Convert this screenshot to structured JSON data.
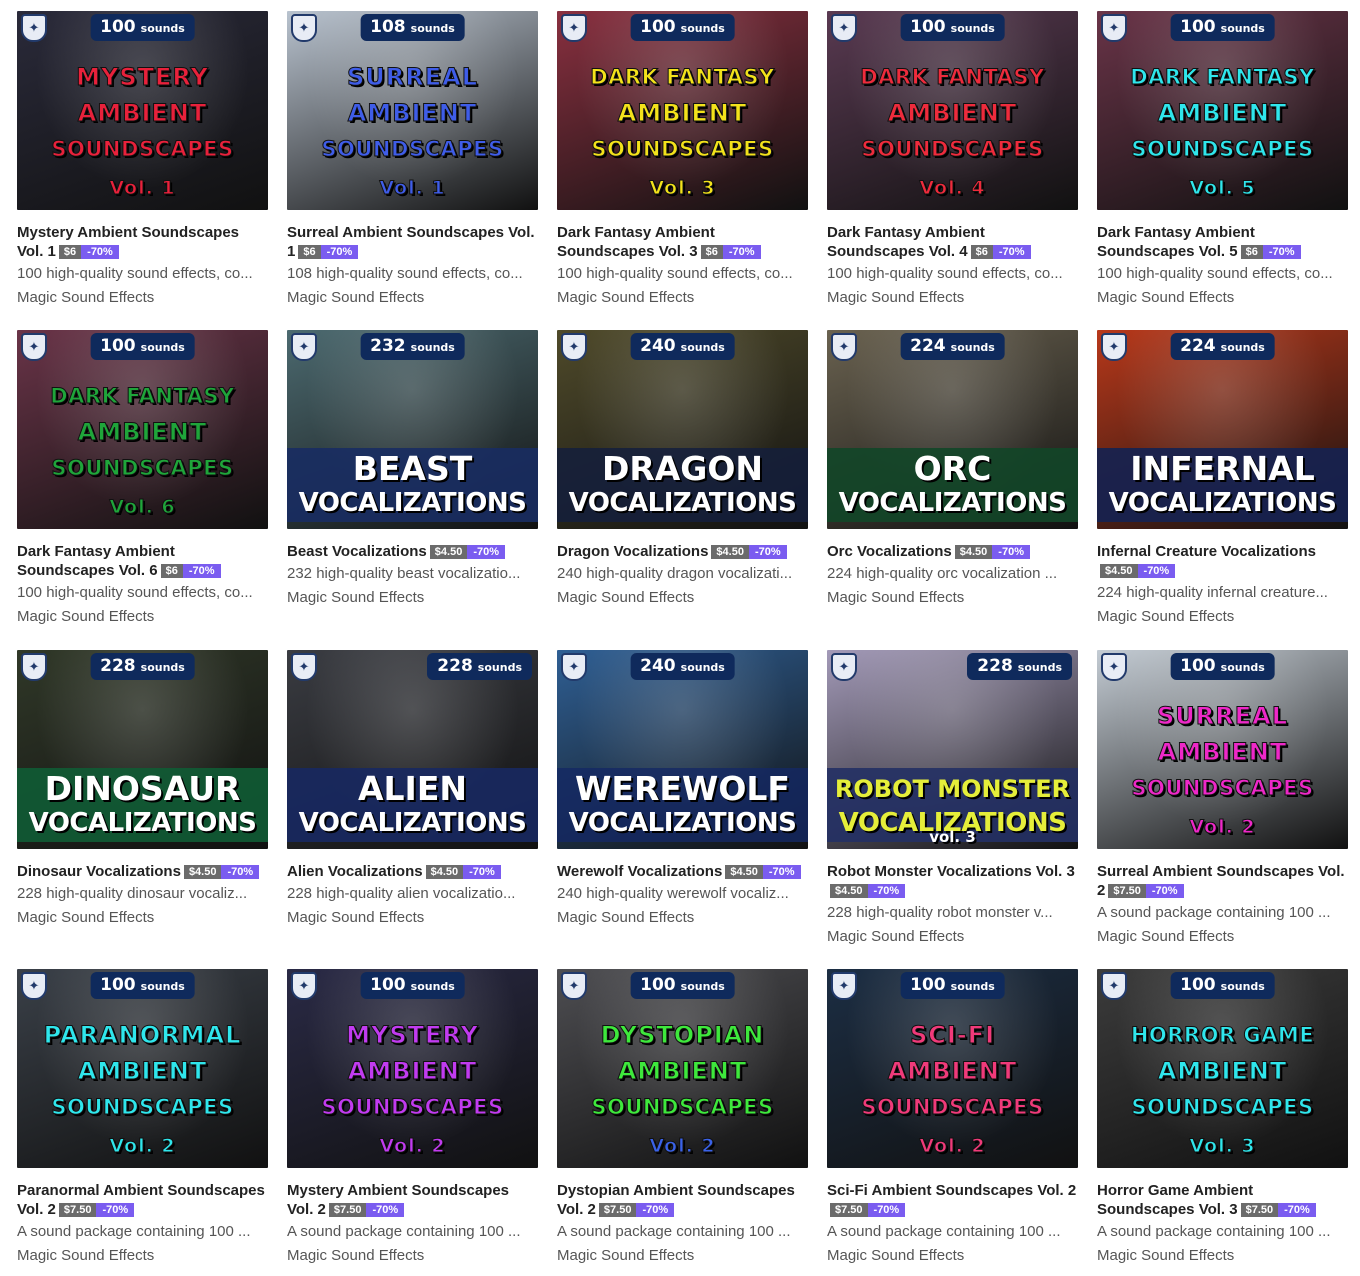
{
  "products": [
    {
      "title": "Mystery Ambient Soundscapes Vol. 1",
      "price": "$6",
      "discount": "-70%",
      "description": "100 high-quality sound effects, co...",
      "author": "Magic Sound Effects",
      "thumb": {
        "count": "100",
        "unit": "sounds",
        "lines": [
          "MYSTERY",
          "AMBIENT",
          "SOUNDSCAPES"
        ],
        "vol": "Vol. 1",
        "text_color": "#e8213b",
        "vol_color": "#e8213b",
        "bg": "#2a2a3a"
      }
    },
    {
      "title": "Surreal Ambient Soundscapes Vol. 1",
      "price": "$6",
      "discount": "-70%",
      "description": "108 high-quality sound effects, co...",
      "author": "Magic Sound Effects",
      "thumb": {
        "count": "108",
        "unit": "sounds",
        "lines": [
          "SURREAL",
          "AMBIENT",
          "SOUNDSCAPES"
        ],
        "vol": "Vol. 1",
        "text_color": "#3f5de8",
        "vol_color": "#3f5de8",
        "bg": "#b9c3cf"
      }
    },
    {
      "title": "Dark Fantasy Ambient Soundscapes Vol. 3",
      "price": "$6",
      "discount": "-70%",
      "description": "100 high-quality sound effects, co...",
      "author": "Magic Sound Effects",
      "thumb": {
        "count": "100",
        "unit": "sounds",
        "lines": [
          "DARK FANTASY",
          "AMBIENT",
          "SOUNDSCAPES"
        ],
        "vol": "Vol. 3",
        "text_color": "#f3e21b",
        "vol_color": "#f3e21b",
        "bg": "#8a3040"
      }
    },
    {
      "title": "Dark Fantasy Ambient Soundscapes Vol. 4",
      "price": "$6",
      "discount": "-70%",
      "description": "100 high-quality sound effects, co...",
      "author": "Magic Sound Effects",
      "thumb": {
        "count": "100",
        "unit": "sounds",
        "lines": [
          "DARK FANTASY",
          "AMBIENT",
          "SOUNDSCAPES"
        ],
        "vol": "Vol. 4",
        "text_color": "#ee2b3c",
        "vol_color": "#ee2b3c",
        "bg": "#5a3a52"
      }
    },
    {
      "title": "Dark Fantasy Ambient Soundscapes Vol. 5",
      "price": "$6",
      "discount": "-70%",
      "description": "100 high-quality sound effects, co...",
      "author": "Magic Sound Effects",
      "thumb": {
        "count": "100",
        "unit": "sounds",
        "lines": [
          "DARK FANTASY",
          "AMBIENT",
          "SOUNDSCAPES"
        ],
        "vol": "Vol. 5",
        "text_color": "#2fe6ec",
        "vol_color": "#2fe6ec",
        "bg": "#6a3448"
      }
    },
    {
      "title": "Dark Fantasy Ambient Soundscapes Vol. 6",
      "price": "$6",
      "discount": "-70%",
      "description": "100 high-quality sound effects, co...",
      "author": "Magic Sound Effects",
      "thumb": {
        "count": "100",
        "unit": "sounds",
        "lines": [
          "DARK FANTASY",
          "AMBIENT",
          "SOUNDSCAPES"
        ],
        "vol": "Vol. 6",
        "text_color": "#1fa53a",
        "vol_color": "#1fa53a",
        "bg": "#6a3448"
      }
    },
    {
      "title": "Beast Vocalizations",
      "price": "$4.50",
      "discount": "-70%",
      "description": "232 high-quality beast vocalizatio...",
      "author": "Magic Sound Effects",
      "thumb": {
        "count": "232",
        "unit": "sounds",
        "band": [
          "BEAST",
          "VOCALIZATIONS"
        ],
        "bg": "#4c6a70",
        "band_color": "rgba(24,44,98,0.9)"
      }
    },
    {
      "title": "Dragon Vocalizations",
      "price": "$4.50",
      "discount": "-70%",
      "description": "240 high-quality dragon vocalizati...",
      "author": "Magic Sound Effects",
      "thumb": {
        "count": "240",
        "unit": "sounds",
        "band": [
          "DRAGON",
          "VOCALIZATIONS"
        ],
        "bg": "#4f4a2a",
        "band_color": "rgba(20,30,60,0.85)"
      }
    },
    {
      "title": "Orc Vocalizations",
      "price": "$4.50",
      "discount": "-70%",
      "description": "224 high-quality orc vocalization ...",
      "author": "Magic Sound Effects",
      "thumb": {
        "count": "224",
        "unit": "sounds",
        "band": [
          "ORC",
          "VOCALIZATIONS"
        ],
        "bg": "#6a6250",
        "band_color": "rgba(18,70,40,0.9)"
      }
    },
    {
      "title": "Infernal Creature Vocalizations",
      "price": "$4.50",
      "discount": "-70%",
      "description": "224 high-quality infernal creature...",
      "author": "Magic Sound Effects",
      "thumb": {
        "count": "224",
        "unit": "sounds",
        "band": [
          "INFERNAL",
          "VOCALIZATIONS"
        ],
        "bg": "#b8381a",
        "band_color": "rgba(22,34,80,0.92)"
      }
    },
    {
      "title": "Dinosaur Vocalizations",
      "price": "$4.50",
      "discount": "-70%",
      "description": "228 high-quality dinosaur vocaliz...",
      "author": "Magic Sound Effects",
      "thumb": {
        "count": "228",
        "unit": "sounds",
        "band": [
          "DINOSAUR",
          "VOCALIZATIONS"
        ],
        "bg": "#303828",
        "band_color": "rgba(16,90,52,0.92)"
      }
    },
    {
      "title": "Alien Vocalizations",
      "price": "$4.50",
      "discount": "-70%",
      "description": "228 high-quality alien vocalizatio...",
      "author": "Magic Sound Effects",
      "thumb": {
        "count": "228",
        "unit": "sounds",
        "band": [
          "ALIEN",
          "VOCALIZATIONS"
        ],
        "bg": "#3a3c42",
        "band_color": "rgba(24,40,96,0.92)",
        "badge_right": true
      }
    },
    {
      "title": "Werewolf Vocalizations",
      "price": "$4.50",
      "discount": "-70%",
      "description": "240 high-quality werewolf vocaliz...",
      "author": "Magic Sound Effects",
      "thumb": {
        "count": "240",
        "unit": "sounds",
        "band": [
          "WEREWOLF",
          "VOCALIZATIONS"
        ],
        "bg": "#2f5f94",
        "band_color": "rgba(20,40,100,0.8)"
      }
    },
    {
      "title": "Robot Monster Vocalizations Vol. 3",
      "price": "$4.50",
      "discount": "-70%",
      "description": "228 high-quality robot monster v...",
      "author": "Magic Sound Effects",
      "thumb": {
        "count": "228",
        "unit": "sounds",
        "band": [
          "ROBOT MONSTER",
          "VOCALIZATIONS"
        ],
        "band_sub": "vol. 3",
        "bg": "#a39ab8",
        "band_color": "rgba(36,48,100,0.9)",
        "band_text": "#e5ee3a",
        "badge_right": true
      }
    },
    {
      "title": "Surreal Ambient Soundscapes Vol. 2",
      "price": "$7.50",
      "discount": "-70%",
      "description": "A sound package containing 100 ...",
      "author": "Magic Sound Effects",
      "thumb": {
        "count": "100",
        "unit": "sounds",
        "lines": [
          "SURREAL",
          "AMBIENT",
          "SOUNDSCAPES"
        ],
        "vol": "Vol. 2",
        "text_color": "#ee28c8",
        "vol_color": "#ee28c8",
        "bg": "#c4ccd4"
      }
    },
    {
      "title": "Paranormal Ambient Soundscapes Vol. 2",
      "price": "$7.50",
      "discount": "-70%",
      "description": "A sound package containing 100 ...",
      "author": "Magic Sound Effects",
      "thumb": {
        "count": "100",
        "unit": "sounds",
        "lines": [
          "PARANORMAL",
          "AMBIENT",
          "SOUNDSCAPES"
        ],
        "vol": "Vol. 2",
        "text_color": "#2fe6ec",
        "vol_color": "#2fe6ec",
        "bg": "#3a4048"
      }
    },
    {
      "title": "Mystery Ambient Soundscapes Vol. 2",
      "price": "$7.50",
      "discount": "-70%",
      "description": "A sound package containing 100 ...",
      "author": "Magic Sound Effects",
      "thumb": {
        "count": "100",
        "unit": "sounds",
        "lines": [
          "MYSTERY",
          "AMBIENT",
          "SOUNDSCAPES"
        ],
        "vol": "Vol. 2",
        "text_color": "#c13bf0",
        "vol_color": "#c13bf0",
        "bg": "#2a2a46"
      }
    },
    {
      "title": "Dystopian Ambient Soundscapes Vol. 2",
      "price": "$7.50",
      "discount": "-70%",
      "description": "A sound package containing 100 ...",
      "author": "Magic Sound Effects",
      "thumb": {
        "count": "100",
        "unit": "sounds",
        "lines": [
          "DYSTOPIAN",
          "AMBIENT",
          "SOUNDSCAPES"
        ],
        "vol": "Vol. 2",
        "text_color": "#3ee83c",
        "vol_color": "#3a62e8",
        "bg": "#4e4e52"
      }
    },
    {
      "title": "Sci-Fi Ambient Soundscapes Vol. 2",
      "price": "$7.50",
      "discount": "-70%",
      "description": "A sound package containing 100 ...",
      "author": "Magic Sound Effects",
      "thumb": {
        "count": "100",
        "unit": "sounds",
        "lines": [
          "SCI-FI",
          "AMBIENT",
          "SOUNDSCAPES"
        ],
        "vol": "Vol. 2",
        "text_color": "#f03a7a",
        "vol_color": "#f03a7a",
        "bg": "#1c2e44"
      }
    },
    {
      "title": "Horror Game Ambient Soundscapes Vol. 3",
      "price": "$7.50",
      "discount": "-70%",
      "description": "A sound package containing 100 ...",
      "author": "Magic Sound Effects",
      "thumb": {
        "count": "100",
        "unit": "sounds",
        "lines": [
          "HORROR GAME",
          "AMBIENT",
          "SOUNDSCAPES"
        ],
        "vol": "Vol. 3",
        "text_color": "#2fe6ec",
        "vol_color": "#2fe6ec",
        "bg": "#3c3c3c"
      }
    }
  ]
}
